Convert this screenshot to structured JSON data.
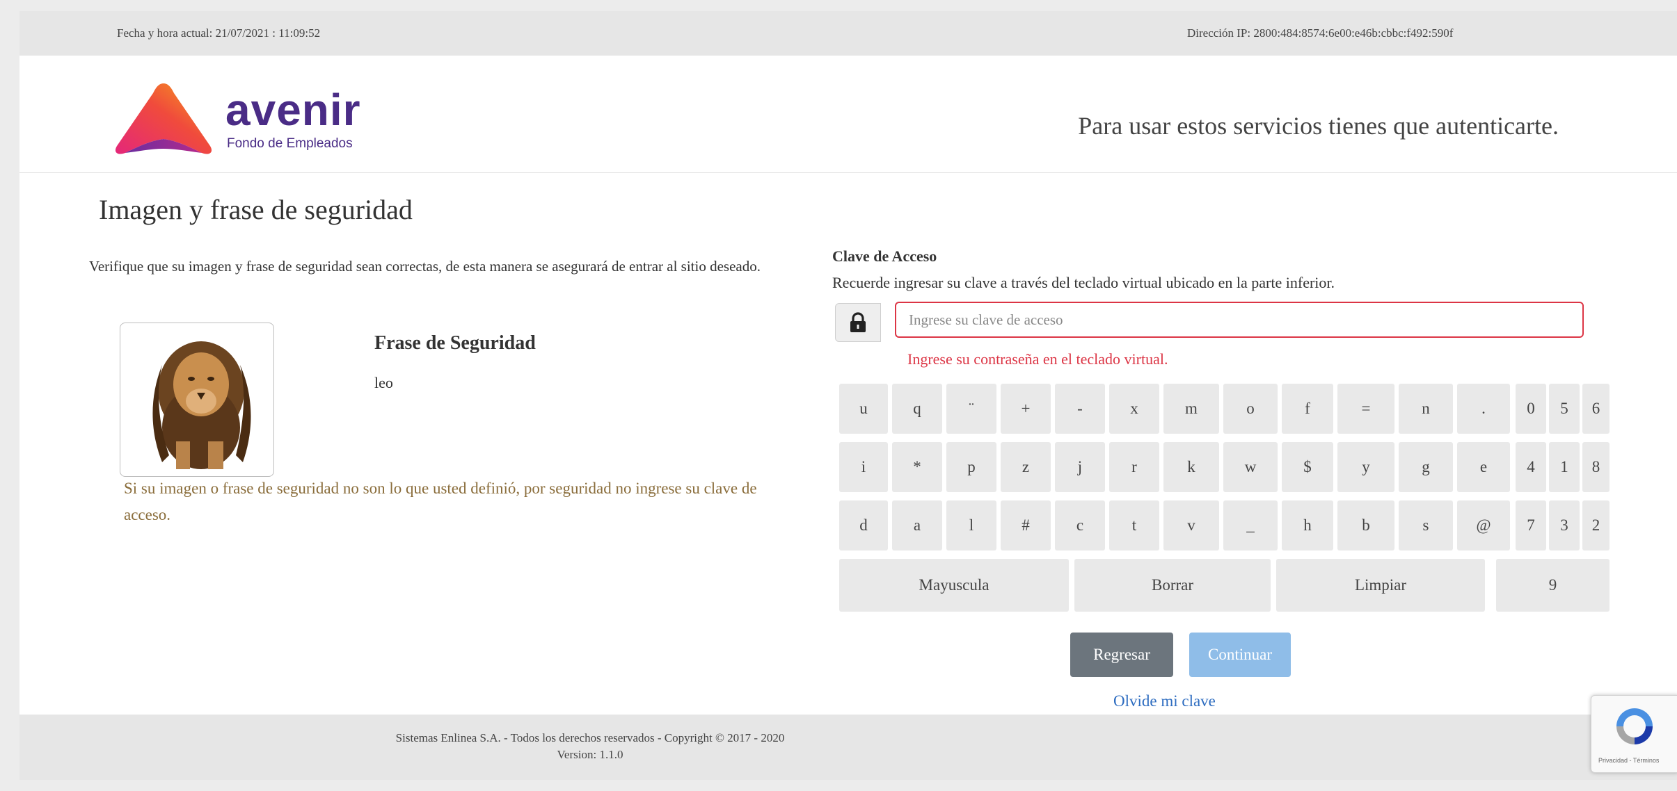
{
  "topbar": {
    "datetime": "Fecha y hora actual: 21/07/2021 : 11:09:52",
    "ip": "Dirección IP: 2800:484:8574:6e00:e46b:cbbc:f492:590f"
  },
  "header": {
    "logo_text": "avenir",
    "logo_sub": "Fondo de Empleados",
    "message": "Para usar estos servicios tienes que autenticarte."
  },
  "security": {
    "title": "Imagen y frase de seguridad",
    "verify_text": "Verifique que su imagen y frase de seguridad sean correctas, de esta manera se asegurará de entrar al sitio deseado.",
    "phrase_title": "Frase de Seguridad",
    "phrase_value": "leo",
    "warning": "Si su imagen o frase de seguridad no son lo que usted definió, por seguridad no ingrese su clave de acceso."
  },
  "access": {
    "title": "Clave de Acceso",
    "hint": "Recuerde ingresar su clave a través del teclado virtual ubicado en la parte inferior.",
    "placeholder": "Ingrese su clave de acceso",
    "error": "Ingrese su contraseña en el teclado virtual."
  },
  "keyboard": {
    "rows": [
      [
        "u",
        "q",
        "¨",
        "+",
        "-",
        "x",
        "m",
        "o",
        "f",
        "=",
        "n",
        "."
      ],
      [
        "i",
        "*",
        "p",
        "z",
        "j",
        "r",
        "k",
        "w",
        "$",
        "y",
        "g",
        "e"
      ],
      [
        "d",
        "a",
        "l",
        "#",
        "c",
        "t",
        "v",
        "_",
        "h",
        "b",
        "s",
        "@"
      ]
    ],
    "num_rows": [
      [
        "0",
        "5",
        "6"
      ],
      [
        "4",
        "1",
        "8"
      ],
      [
        "7",
        "3",
        "2"
      ]
    ],
    "mayuscula": "Mayuscula",
    "borrar": "Borrar",
    "limpiar": "Limpiar",
    "nine": "9"
  },
  "buttons": {
    "back": "Regresar",
    "continue": "Continuar",
    "forgot": "Olvide mi clave"
  },
  "footer": {
    "line1": "Sistemas Enlinea S.A. - Todos los derechos reservados - Copyright © 2017 - 2020",
    "line2": "Version: 1.1.0"
  },
  "recaptcha": {
    "text": "Privacidad - Términos"
  },
  "colors": {
    "error": "#dc3545",
    "warning": "#8a6d3b",
    "link": "#2d6cc0",
    "btn_back": "#6c757d",
    "btn_continue": "#8fbde8",
    "brand": "#4a2c86"
  }
}
